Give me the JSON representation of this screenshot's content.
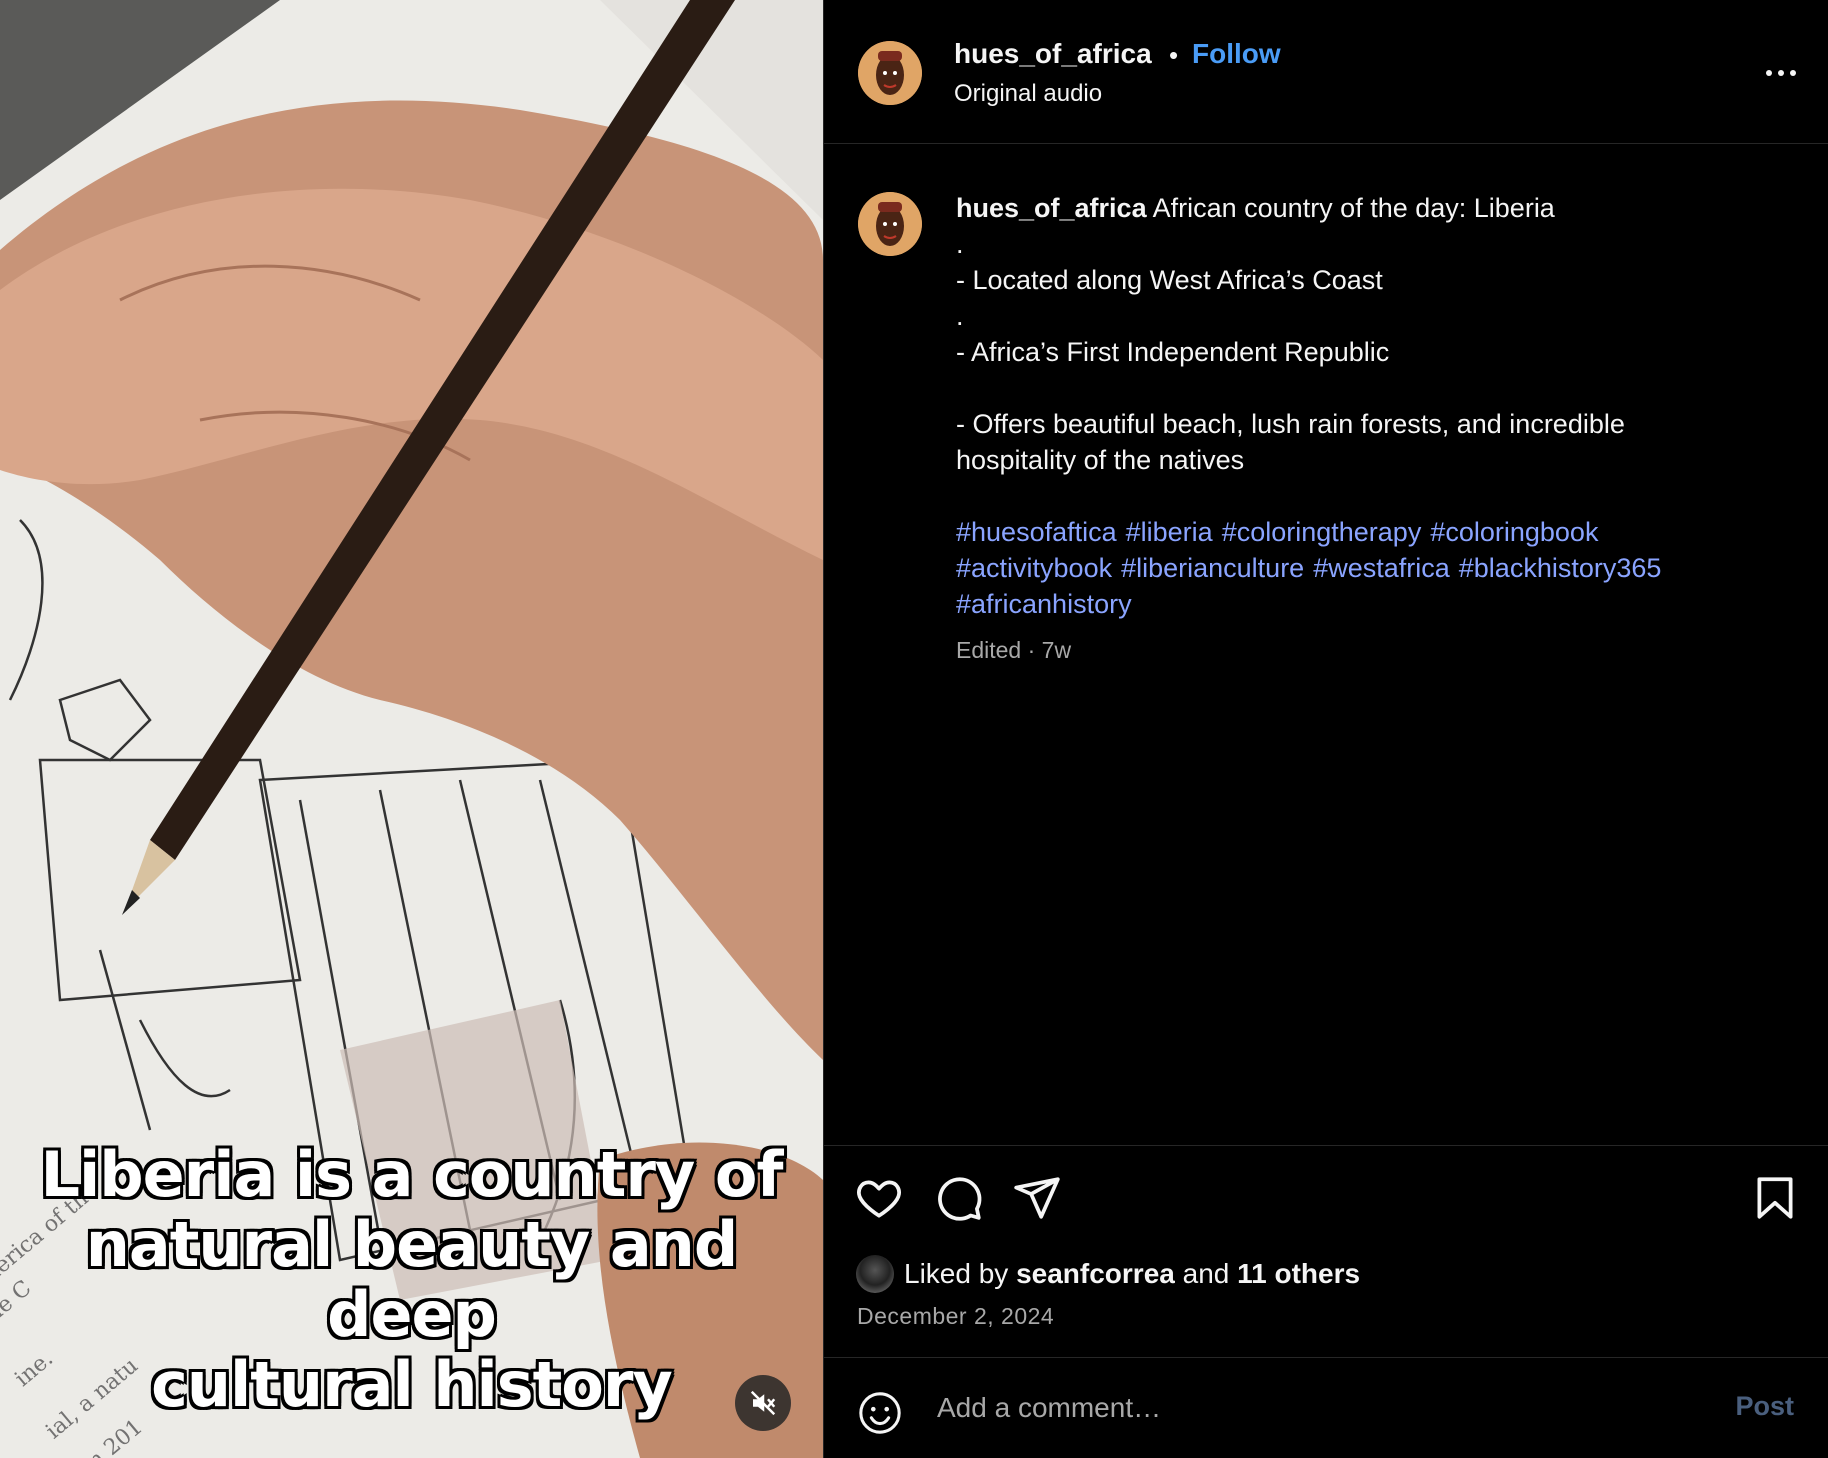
{
  "media": {
    "caption_lines": [
      "Liberia is a country of",
      "natural beauty and deep",
      "cultural history"
    ],
    "mute_icon": "speaker-muted-icon"
  },
  "header": {
    "username": "hues_of_africa",
    "separator": "•",
    "follow_label": "Follow",
    "audio_label": "Original audio",
    "more_icon": "more-horizontal-icon"
  },
  "post_caption": {
    "username": "hues_of_africa",
    "lines": [
      "African country of the day: Liberia",
      ".",
      "- Located along West Africa’s Coast",
      ".",
      "- Africa’s First Independent Republic",
      "",
      "- Offers beautiful beach, lush rain forests, and incredible",
      "hospitality of the natives"
    ],
    "hashtags": [
      "#huesofaftica",
      "#liberia",
      "#coloringtherapy",
      "#coloringbook",
      "#activitybook",
      "#liberianculture",
      "#westafrica",
      "#blackhistory365",
      "#africanhistory"
    ],
    "meta": "Edited · 7w"
  },
  "actions": {
    "like_icon": "heart-icon",
    "comment_icon": "comment-bubble-icon",
    "share_icon": "paper-plane-icon",
    "save_icon": "bookmark-icon"
  },
  "likes": {
    "prefix": "Liked by",
    "user": "seanfcorrea",
    "joiner": "and",
    "others": "11 others"
  },
  "date": "December 2, 2024",
  "comment": {
    "placeholder": "Add a comment…",
    "post_label": "Post",
    "emoji_icon": "smiley-icon"
  },
  "colors": {
    "accent_link": "#4a9cf6",
    "hashtag": "#8aa4ff",
    "muted_text": "#a8a8a8",
    "background": "#000000"
  }
}
